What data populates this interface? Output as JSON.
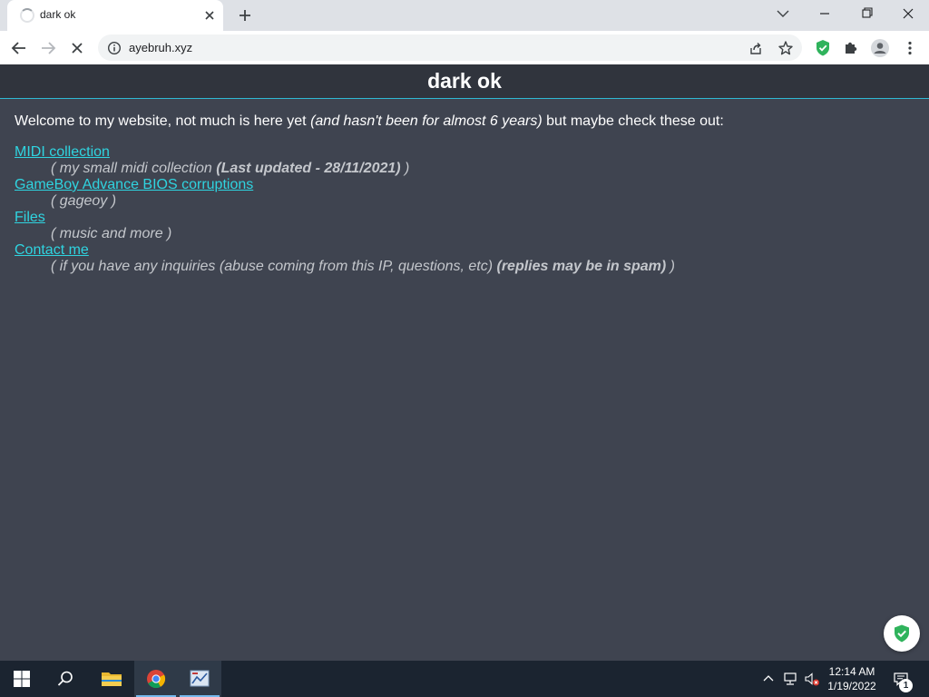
{
  "browser": {
    "tab_title": "dark ok",
    "url": "ayebruh.xyz"
  },
  "page": {
    "heading": "dark ok",
    "welcome": {
      "text_before": "Welcome to my website, not much is here yet ",
      "emphasis": "(and hasn't been for almost 6 years)",
      "text_after": " but maybe check these out:"
    },
    "links": [
      {
        "label": "MIDI collection",
        "desc_before": "( my small midi collection ",
        "desc_bold": "(Last updated - 28/11/2021)",
        "desc_after": " )"
      },
      {
        "label": "GameBoy Advance BIOS corruptions",
        "desc_before": "( gageoy )",
        "desc_bold": "",
        "desc_after": ""
      },
      {
        "label": "Files",
        "desc_before": "( music and more )",
        "desc_bold": "",
        "desc_after": ""
      },
      {
        "label": "Contact me",
        "desc_before": "( if you have any inquiries (abuse coming from this IP, questions, etc) ",
        "desc_bold": "(replies may be in spam)",
        "desc_after": " )"
      }
    ]
  },
  "taskbar": {
    "time": "12:14 AM",
    "date": "1/19/2022",
    "notification_count": "1"
  },
  "colors": {
    "page_bg": "#3f4450",
    "header_bg": "#30343d",
    "accent": "#2fb9d3",
    "link": "#2fd4e0",
    "desc_text": "#c4c7cc",
    "shield_green": "#2fb35c"
  },
  "icons": [
    "loading-spinner-icon",
    "close-icon",
    "plus-icon",
    "chevron-down-icon",
    "minimize-icon",
    "restore-icon",
    "back-arrow-icon",
    "forward-arrow-icon",
    "stop-icon",
    "info-icon",
    "share-icon",
    "star-icon",
    "shield-extension-icon",
    "puzzle-extensions-icon",
    "profile-icon",
    "menu-dots-icon",
    "windows-start-icon",
    "search-icon",
    "file-explorer-icon",
    "chrome-icon",
    "app-icon",
    "chevron-up-icon",
    "network-icon",
    "volume-muted-icon",
    "notification-icon"
  ]
}
